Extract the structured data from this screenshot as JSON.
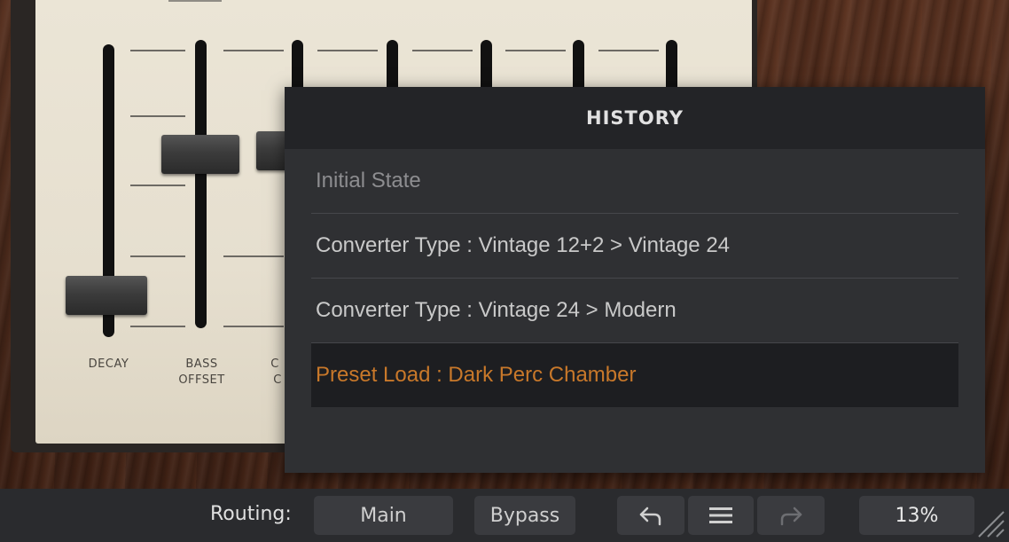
{
  "history": {
    "title": "HISTORY",
    "items": [
      {
        "label": "Initial State"
      },
      {
        "label": "Converter Type : Vintage 12+2 > Vintage 24"
      },
      {
        "label": "Converter Type : Vintage 24 > Modern"
      },
      {
        "label": "Preset Load : Dark Perc Chamber"
      }
    ]
  },
  "sliders": {
    "decay_label": "DECAY",
    "bass_label_1": "BASS",
    "bass_label_2": "OFFSET",
    "partial_label_1": "C",
    "partial_label_2": "C"
  },
  "toolbar": {
    "routing_label": "Routing:",
    "main_label": "Main",
    "bypass_label": "Bypass",
    "undo_icon": "undo-icon",
    "menu_icon": "menu-icon",
    "redo_icon": "redo-icon",
    "cpu_value": "13%"
  },
  "colors": {
    "accent": "#c8782a",
    "toolbar_bg": "#2a2b2e",
    "popup_bg": "#2f3033"
  }
}
